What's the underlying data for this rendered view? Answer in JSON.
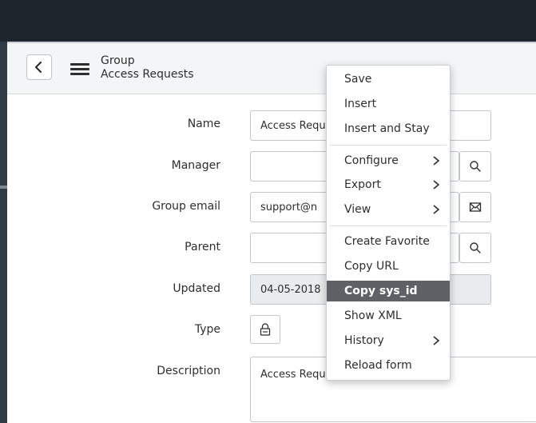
{
  "header": {
    "title_line1": "Group",
    "title_line2": "Access Requests",
    "back_icon": "chevron-left-icon",
    "menu_icon": "hamburger-icon"
  },
  "form": {
    "name_label": "Name",
    "name_value": "Access Requ",
    "manager_label": "Manager",
    "manager_value": "",
    "group_email_label": "Group email",
    "group_email_value": "support@n",
    "parent_label": "Parent",
    "parent_value": "",
    "updated_label": "Updated",
    "updated_value": "04-05-2018",
    "type_label": "Type",
    "description_label": "Description",
    "description_value": "Access Requ"
  },
  "context_menu": {
    "items": [
      {
        "label": "Save",
        "submenu": false
      },
      {
        "label": "Insert",
        "submenu": false
      },
      {
        "label": "Insert and Stay",
        "submenu": false
      },
      {
        "label": "Configure",
        "submenu": true
      },
      {
        "label": "Export",
        "submenu": true
      },
      {
        "label": "View",
        "submenu": true
      },
      {
        "label": "Create Favorite",
        "submenu": false
      },
      {
        "label": "Copy URL",
        "submenu": false
      },
      {
        "label": "Copy sys_id",
        "submenu": false,
        "highlighted": true
      },
      {
        "label": "Show XML",
        "submenu": false
      },
      {
        "label": "History",
        "submenu": true
      },
      {
        "label": "Reload form",
        "submenu": false
      }
    ]
  },
  "colors": {
    "topbar": "#1e262d",
    "header_bg": "#f4f5f6",
    "menu_highlight": "#5e6166",
    "field_border": "#bfc5cb",
    "readonly_bg": "#e9ebed"
  }
}
